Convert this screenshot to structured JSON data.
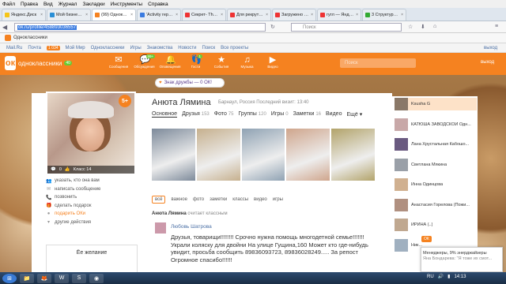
{
  "browser": {
    "menu": [
      "Файл",
      "Правка",
      "Вид",
      "Журнал",
      "Закладки",
      "Инструменты",
      "Справка"
    ],
    "tabs": [
      {
        "label": "Яндекс.Диск",
        "color": "#f5c518"
      },
      {
        "label": "Мой бизнес — ...",
        "color": "#2a8fd6"
      },
      {
        "label": "(99) Одноклас...",
        "color": "#f58220",
        "active": true
      },
      {
        "label": "'Activity repor...",
        "color": "#3a7be0"
      },
      {
        "label": "Секрет- The S...",
        "color": "#e33"
      },
      {
        "label": "Для рекрутир...",
        "color": "#e33"
      },
      {
        "label": "Загружено 0 ...",
        "color": "#e33"
      },
      {
        "label": "гугл — Яндек...",
        "color": "#e33"
      },
      {
        "label": "3 Структура - ...",
        "color": "#3a3"
      }
    ],
    "url_selected": "ok.ru/profile/458893036557",
    "search_placeholder": "Поиск",
    "bookmark": "Одноклассники"
  },
  "portal": {
    "items": [
      "Mail.Ru",
      "Почта",
      "Мой Мир",
      "Одноклассники",
      "Игры",
      "Знакомства",
      "Новости",
      "Поиск",
      "Все проекты"
    ],
    "mail_badge": "1 034",
    "exit": "выход"
  },
  "okheader": {
    "logo_text": "одноклассники",
    "logo_badge": "40",
    "nav": [
      {
        "label": "Сообщения",
        "icon": "✉"
      },
      {
        "label": "Обсуждения",
        "icon": "💬",
        "count": "99+"
      },
      {
        "label": "Оповещения",
        "icon": "🔔"
      },
      {
        "label": "Гости",
        "icon": "👣",
        "count": "1"
      },
      {
        "label": "События",
        "icon": "★"
      },
      {
        "label": "Музыка",
        "icon": "♫"
      },
      {
        "label": "Видео",
        "icon": "▶"
      }
    ],
    "search_placeholder": "Поиск",
    "exit": "выход"
  },
  "friendship": "Знак дружбы — 0 ОК!",
  "profile": {
    "name": "Анюта Лямина",
    "info": "Барнаул, Россия  Последний визит: 13:40",
    "badge": "5+",
    "photo_bar": [
      "0",
      "Класс 14"
    ],
    "actions": [
      {
        "label": "указать, кто она вам",
        "icon": "👥"
      },
      {
        "label": "написать сообщение",
        "icon": "✉"
      },
      {
        "label": "позвонить",
        "icon": "📞"
      },
      {
        "label": "сделать подарок",
        "icon": "🎁"
      },
      {
        "label": "подарить ОКи",
        "icon": "●",
        "orange": true
      },
      {
        "label": "другие действия",
        "icon": "▾"
      }
    ],
    "wish_title": "Ёе желание",
    "tabs": [
      {
        "label": "Основное",
        "count": "",
        "active": true
      },
      {
        "label": "Друзья",
        "count": "153"
      },
      {
        "label": "Фото",
        "count": "75"
      },
      {
        "label": "Группы",
        "count": "120"
      },
      {
        "label": "Игры",
        "count": "0"
      },
      {
        "label": "Заметки",
        "count": "16"
      },
      {
        "label": "Видео",
        "count": ""
      },
      {
        "label": "Ещё ▾",
        "count": ""
      }
    ],
    "photo_colors": [
      "#7d8a9a",
      "#c6b08e",
      "#8fa2b3",
      "#cfa58c",
      "#b2a36a"
    ]
  },
  "feed": {
    "tabs": [
      "всё",
      "важное",
      "фото",
      "заметки",
      "классы",
      "видео",
      "игры"
    ],
    "header_name": "Анюта Лямина",
    "header_rest": " считает классным",
    "post_author": "Любовь Шатрова",
    "post_text": "Друзья, товарищи!!!!!!!! Срочно нужна помощь многодетной семье!!!!!!! Украли коляску для двойни На улице Гущина,160  Может кто где-нибудь увидит, просьба сообщить 89836093723, 89836028249..... За репост Огромное спасибо!!!!!!"
  },
  "friends": [
    {
      "name": "Ksusha G",
      "color": "#8a7868"
    },
    {
      "name": "КАТЮША ЗАВОДСКОЙ Одн...",
      "color": "#c8a8a8"
    },
    {
      "name": "Лана Хрустальная Кабошо...",
      "color": "#6a5a80"
    },
    {
      "name": "Светлана Мякина",
      "color": "#9aa0a8"
    },
    {
      "name": "Инна Одинцова",
      "color": "#d0b090"
    },
    {
      "name": "Анастасия Горелова (Пожи...",
      "color": "#b09080"
    },
    {
      "name": "ИРИНА (..)",
      "color": "#c0a890"
    },
    {
      "name": "Ник...",
      "color": "#a0b0c0"
    }
  ],
  "notification": {
    "tag": "ОК",
    "title": "Менеджеры, 9% энерджайзеры",
    "sub": "Яна Бондарева: \"Я тоже их смот..."
  },
  "taskbar": {
    "lang": "RU",
    "time": "14:13"
  }
}
